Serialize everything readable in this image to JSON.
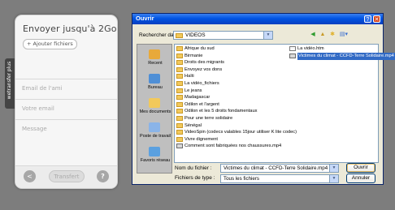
{
  "colors": {
    "background": "#7d7d7d",
    "titlebar": "#0054e3",
    "selection": "#316ac5",
    "wetransfer_tab": "#444444"
  },
  "wetransfer": {
    "title": "Envoyer jusqu'à 2Go",
    "add_files": "+ Ajouter fichiers",
    "email_friend_placeholder": "Email de l'ami",
    "your_email_placeholder": "Votre email",
    "message_placeholder": "Message",
    "transfer_label": "Transfert",
    "share_icon": "share-icon",
    "help_label": "?",
    "tab_label": "wetransfer plus"
  },
  "dialog": {
    "title": "Ouvrir",
    "help_button": "?",
    "close_button": "✕",
    "look_in_label": "Rechercher dans :",
    "look_in_value": "VIDEOS",
    "toolbar_icons": [
      "back-icon",
      "up-folder-icon",
      "new-folder-icon",
      "views-icon"
    ],
    "places": [
      {
        "label": "Recent",
        "icon": "recent-icon",
        "color": "#e8a93a"
      },
      {
        "label": "Bureau",
        "icon": "desktop-icon",
        "color": "#4f8fd6"
      },
      {
        "label": "Mes documents",
        "icon": "my-documents-icon",
        "color": "#f2c95b"
      },
      {
        "label": "Poste de travail",
        "icon": "my-computer-icon",
        "color": "#8ab4e8"
      },
      {
        "label": "Favoris réseau",
        "icon": "network-icon",
        "color": "#5aa0e0"
      }
    ],
    "files_col1": [
      {
        "name": "Afrique du sud",
        "type": "folder"
      },
      {
        "name": "Birmanie",
        "type": "folder"
      },
      {
        "name": "Droits des migrants",
        "type": "folder"
      },
      {
        "name": "Envoyez vos dons",
        "type": "folder"
      },
      {
        "name": "Haïti",
        "type": "folder"
      },
      {
        "name": "La vidéo_fichiers",
        "type": "folder"
      },
      {
        "name": "Le jeans",
        "type": "folder"
      },
      {
        "name": "Madagascar",
        "type": "folder"
      },
      {
        "name": "Odilon et l'argent",
        "type": "folder"
      },
      {
        "name": "Odilon et les 5 droits fondamentaux",
        "type": "folder"
      },
      {
        "name": "Pour une terre solidaire",
        "type": "folder"
      },
      {
        "name": "Sénégal",
        "type": "folder"
      },
      {
        "name": "VideoSpin (codecs valables 15jour utiliser K lite codec)",
        "type": "folder"
      },
      {
        "name": "Vivre dignement",
        "type": "folder"
      },
      {
        "name": "Comment sont fabriquées nos chaussures.mp4",
        "type": "video"
      }
    ],
    "files_col2": [
      {
        "name": "La vidéo.htm",
        "type": "doc"
      },
      {
        "name": "Victimes du climat - CCFD-Terre Solidaire.mp4",
        "type": "video",
        "selected": true
      }
    ],
    "filename_label": "Nom du fichier :",
    "filename_value": "Victimes du climat - CCFD-Terre Solidaire.mp4",
    "filetype_label": "Fichiers de type :",
    "filetype_value": "Tous les fichiers",
    "open_button": "Ouvrir",
    "cancel_button": "Annuler"
  }
}
